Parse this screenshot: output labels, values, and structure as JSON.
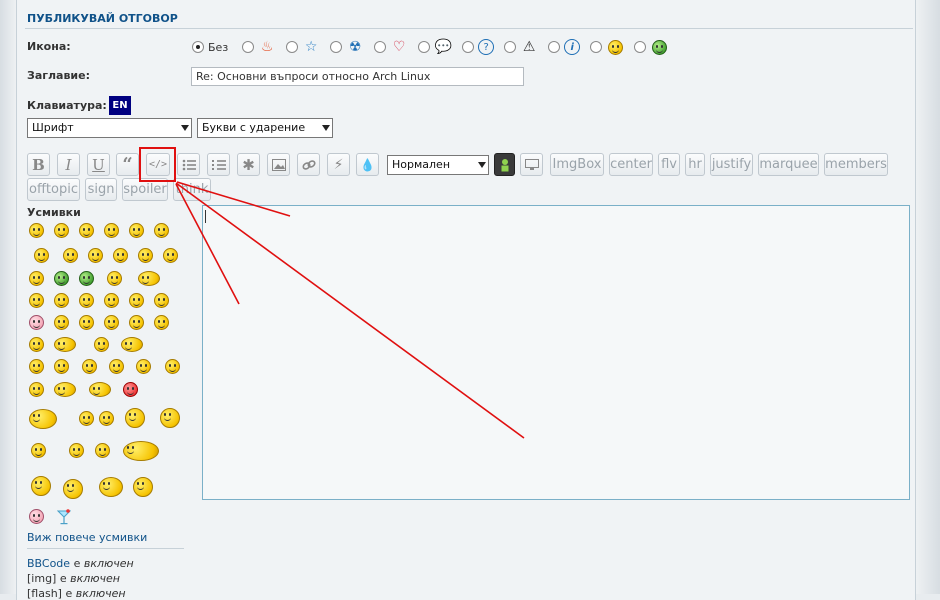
{
  "form": {
    "title": "ПУБЛИКУВАЙ ОТГОВОР",
    "icon_label": "Икона:",
    "icon_none_label": "Без",
    "icons": [
      "fire-icon",
      "star-icon",
      "radioactive-icon",
      "heart-icon",
      "speech-bubble-icon",
      "question-icon",
      "warning-icon",
      "info-icon",
      "wink-smiley-icon",
      "grin-green-smiley-icon"
    ],
    "subject_label": "Заглавие:",
    "subject_value": "Re: Основни въпроси относно Arch Linux",
    "keyboard_label": "Клавиатура:",
    "keyboard_value": "EN",
    "font_select": "Шрифт",
    "accent_select": "Букви с ударение",
    "size_select": "Нормален"
  },
  "toolbar": {
    "text_buttons_row1": [
      "ImgBox",
      "center",
      "flv",
      "hr",
      "justify",
      "marquee",
      "members"
    ],
    "text_buttons_row2": [
      "offtopic",
      "sign",
      "spoiler",
      "think"
    ]
  },
  "smilies": {
    "title": "Усмивки",
    "more_link": "Виж повече усмивки"
  },
  "options": [
    {
      "name": "BBCode",
      "state": "включен"
    },
    {
      "name": "[img]",
      "state": "включен"
    },
    {
      "name": "[flash]",
      "state": "включен"
    }
  ],
  "options_connector": "е",
  "colors": {
    "annotation": "#e01010",
    "link": "#105289",
    "badge": "#000080"
  }
}
